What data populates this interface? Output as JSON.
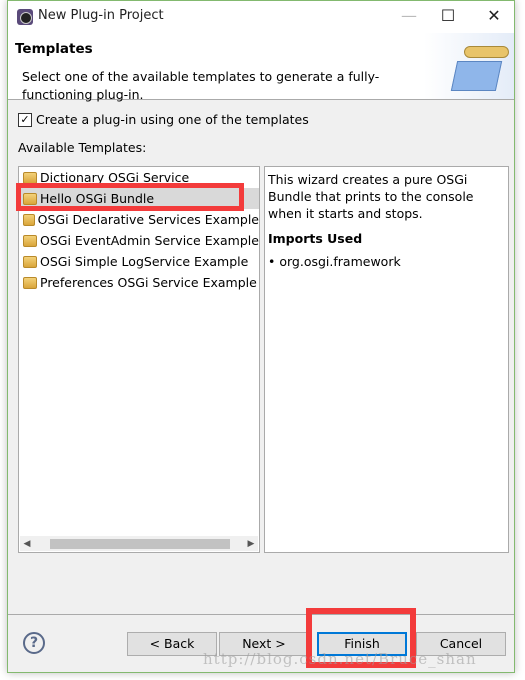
{
  "window": {
    "title": "New Plug-in Project",
    "minimize": "—",
    "maximize": "☐",
    "close": "✕"
  },
  "header": {
    "title": "Templates",
    "description": "Select one of the available templates to generate a fully-functioning plug-in."
  },
  "checkbox": {
    "label": "Create a plug-in using one of the templates",
    "checked": true,
    "mark": "✓"
  },
  "templates_label": "Available Templates:",
  "templates": [
    {
      "label": "Dictionary OSGi Service",
      "selected": false
    },
    {
      "label": "Hello OSGi Bundle",
      "selected": true
    },
    {
      "label": "OSGi Declarative Services Example",
      "selected": false
    },
    {
      "label": "OSGi EventAdmin Service Example",
      "selected": false
    },
    {
      "label": "OSGi Simple LogService Example",
      "selected": false
    },
    {
      "label": "Preferences OSGi Service Example",
      "selected": false
    }
  ],
  "scroll": {
    "left": "◀",
    "right": "▶"
  },
  "description": {
    "text": "This wizard creates a pure OSGi Bundle that prints to the console when it starts and stops.",
    "imports_title": "Imports Used",
    "imports": [
      "org.osgi.framework"
    ]
  },
  "buttons": {
    "help": "?",
    "back": "< Back",
    "next": "Next >",
    "finish": "Finish",
    "cancel": "Cancel"
  },
  "watermark": "http://blog.csdn.net/Bruce_shan",
  "colors": {
    "highlight": "#f33b3b",
    "default_button": "#0078d7"
  }
}
